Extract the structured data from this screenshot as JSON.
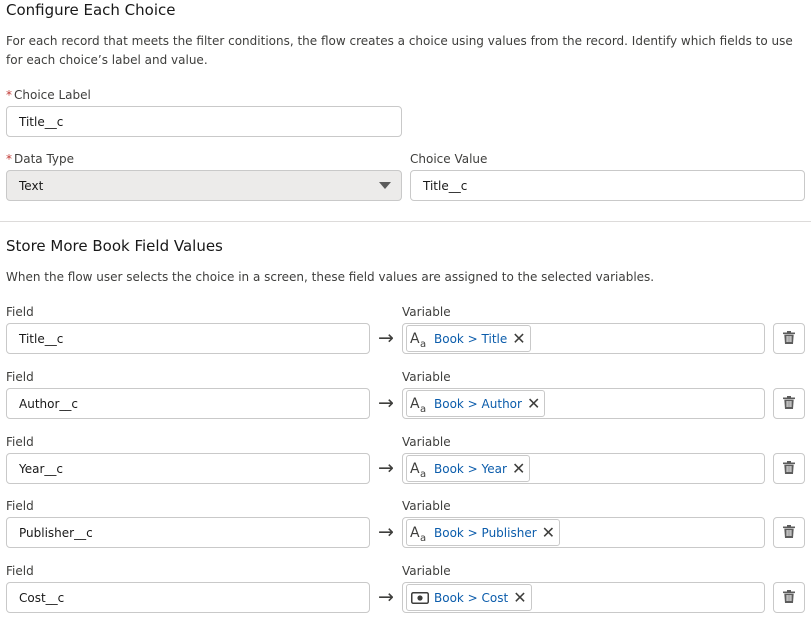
{
  "configure": {
    "title": "Configure Each Choice",
    "description": "For each record that meets the filter conditions, the flow creates a choice using values from the record. Identify which fields to use for each choice’s label and value.",
    "choice_label": {
      "label": "Choice Label",
      "value": "Title__c",
      "required": "*"
    },
    "data_type": {
      "label": "Data Type",
      "value": "Text",
      "required": "*"
    },
    "choice_value": {
      "label": "Choice Value",
      "value": "Title__c"
    }
  },
  "store": {
    "title": "Store More Book Field Values",
    "description": "When the flow user selects the choice in a screen, these field values are assigned to the selected variables.",
    "field_label": "Field",
    "variable_label": "Variable",
    "rows": [
      {
        "field": "Title__c",
        "variable": "Book > Title",
        "icon": "text-icon"
      },
      {
        "field": "Author__c",
        "variable": "Book > Author",
        "icon": "text-icon"
      },
      {
        "field": "Year__c",
        "variable": "Book > Year",
        "icon": "text-icon"
      },
      {
        "field": "Publisher__c",
        "variable": "Book > Publisher",
        "icon": "text-icon"
      },
      {
        "field": "Cost__c",
        "variable": "Book > Cost",
        "icon": "currency-icon"
      }
    ]
  },
  "icons": {
    "arrow": "→",
    "remove": "✕",
    "text_glyph": "Aa"
  }
}
